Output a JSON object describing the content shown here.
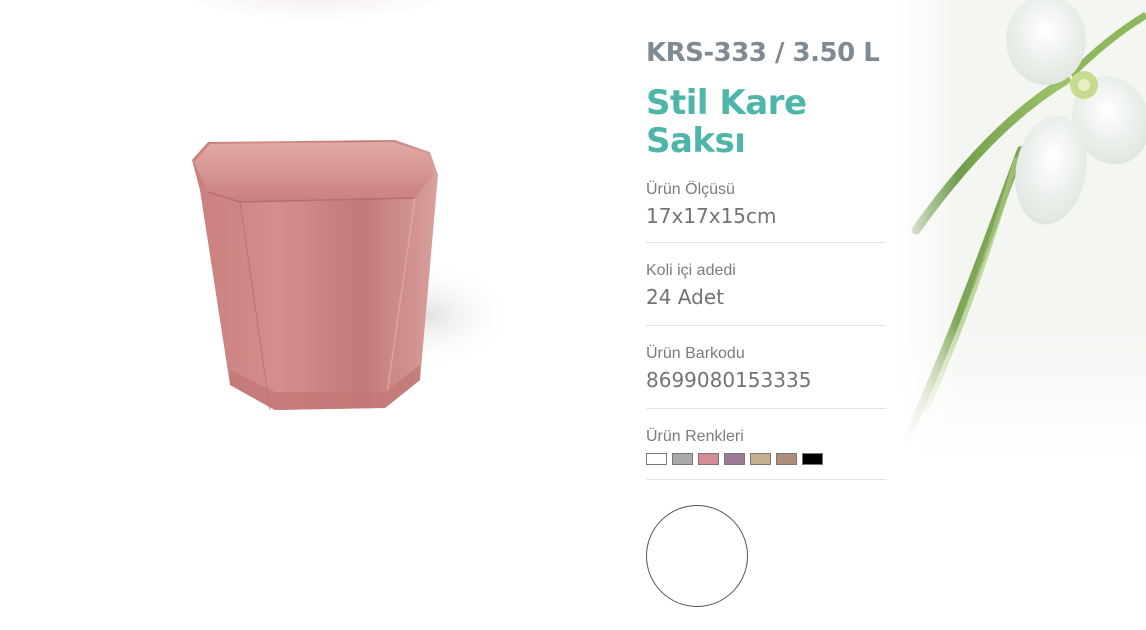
{
  "product": {
    "code": "KRS-333 / 3.50 L",
    "title": "Stil Kare Saksı"
  },
  "specs": [
    {
      "label": "Ürün Ölçüsü",
      "value": "17x17x15cm"
    },
    {
      "label": "Koli içi adedi",
      "value": "24 Adet"
    },
    {
      "label": "Ürün Barkodu",
      "value": "8699080153335"
    }
  ],
  "colors": {
    "label": "Ürün Renkleri",
    "swatches": [
      "#ffffff",
      "#a7a9ab",
      "#d68c93",
      "#9b7896",
      "#c5ad8f",
      "#ad8e7a",
      "#000000"
    ]
  },
  "accent": "#4db6a8",
  "product_color": "#d48f8c"
}
